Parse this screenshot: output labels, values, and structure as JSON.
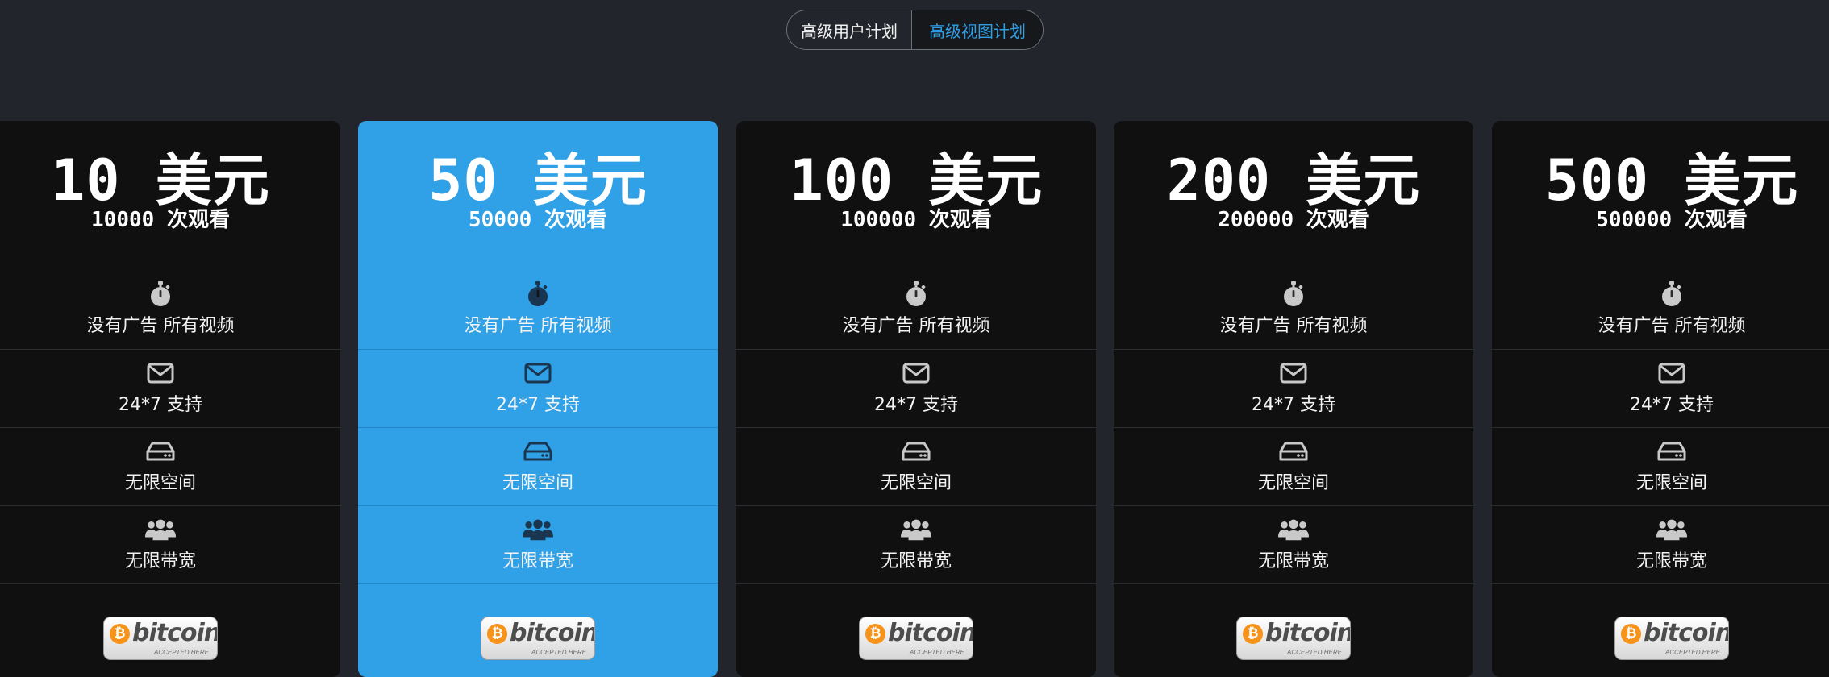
{
  "toggle": {
    "options": [
      {
        "label": "高级用户计划",
        "active": false
      },
      {
        "label": "高级视图计划",
        "active": true
      }
    ]
  },
  "colors": {
    "background": "#22252b",
    "card": "#101010",
    "featured_card": "#30a1e6",
    "accent": "#2f9fe3",
    "icon_dark_card": "#c9c9c9",
    "icon_featured_card": "#1a3550"
  },
  "features": [
    {
      "icon": "stopwatch-icon",
      "label": "没有广告 所有视频"
    },
    {
      "icon": "envelope-icon",
      "label": "24*7 支持"
    },
    {
      "icon": "hard-drive-icon",
      "label": "无限空间"
    },
    {
      "icon": "users-icon",
      "label": "无限带宽"
    }
  ],
  "plans": [
    {
      "price": "10 美元",
      "views": "10000 次观看",
      "featured": false
    },
    {
      "price": "50 美元",
      "views": "50000 次观看",
      "featured": true
    },
    {
      "price": "100 美元",
      "views": "100000 次观看",
      "featured": false
    },
    {
      "price": "200 美元",
      "views": "200000 次观看",
      "featured": false
    },
    {
      "price": "500 美元",
      "views": "500000 次观看",
      "featured": false
    }
  ],
  "payment_badge": {
    "symbol": "₿",
    "word": "bitcoin",
    "subtext": "ACCEPTED HERE"
  }
}
